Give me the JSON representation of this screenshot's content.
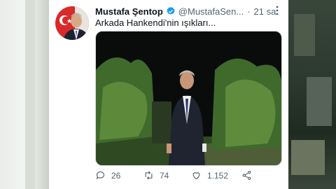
{
  "tweet": {
    "author_name": "Mustafa Şentop",
    "handle": "@MustafaSen...",
    "separator": "·",
    "time": "21 sa",
    "text": "Arkada Hankendi'nin ışıkları...",
    "replies": "26",
    "retweets": "74",
    "likes": "1.152"
  },
  "colors": {
    "accent": "#1d9bf0",
    "text": "#0f1419",
    "muted": "#536471"
  },
  "icons": [
    "verified-badge-icon",
    "more-icon",
    "reply-icon",
    "retweet-icon",
    "like-icon",
    "share-icon"
  ]
}
